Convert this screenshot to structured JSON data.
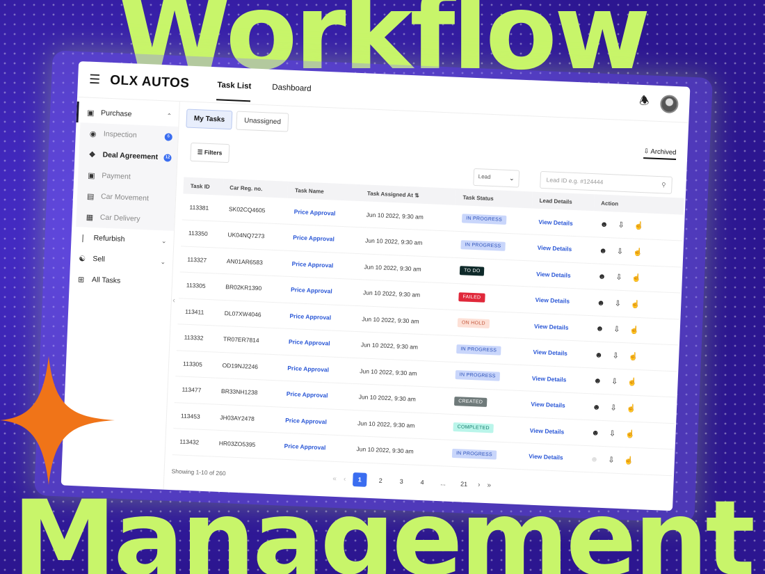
{
  "headline": {
    "top": "Workflow",
    "bottom": "Management"
  },
  "app": {
    "logo": "OLX AUTOS",
    "nav": [
      {
        "label": "Task List",
        "active": true
      },
      {
        "label": "Dashboard",
        "active": false
      }
    ]
  },
  "sidebar": {
    "purchase": "Purchase",
    "sub": [
      {
        "label": "Inspection",
        "badge": "6",
        "bold": false
      },
      {
        "label": "Deal Agreement",
        "badge": "12",
        "bold": true
      },
      {
        "label": "Payment",
        "badge": "",
        "bold": false
      },
      {
        "label": "Car Movement",
        "badge": "",
        "bold": false
      },
      {
        "label": "Car Delivery",
        "badge": "",
        "bold": false
      }
    ],
    "refurbish": "Refurbish",
    "sell": "Sell",
    "all_tasks": "All Tasks"
  },
  "main": {
    "tabs": [
      "My Tasks",
      "Unassigned"
    ],
    "archived": "Archived",
    "filters": "Filters",
    "lead_select": "Lead",
    "search_placeholder": "Lead ID e.g. #124444",
    "columns": [
      "Task ID",
      "Car Reg. no.",
      "Task Name",
      "Task Assigned At",
      "Task Status",
      "Lead Details",
      "Action"
    ],
    "rows": [
      {
        "id": "113381",
        "reg": "SK02CQ4605",
        "task": "Price Approval",
        "assigned": "Jun 10 2022, 9:30 am",
        "status": "IN PROGRESS",
        "lead": "View Details"
      },
      {
        "id": "113350",
        "reg": "UK04NQ7273",
        "task": "Price Approval",
        "assigned": "Jun 10 2022, 9:30 am",
        "status": "IN PROGRESS",
        "lead": "View Details"
      },
      {
        "id": "113327",
        "reg": "AN01AR6583",
        "task": "Price Approval",
        "assigned": "Jun 10 2022, 9:30 am",
        "status": "TO DO",
        "lead": "View Details"
      },
      {
        "id": "113305",
        "reg": "BR02KR1390",
        "task": "Price Approval",
        "assigned": "Jun 10 2022, 9:30 am",
        "status": "FAILED",
        "lead": "View Details"
      },
      {
        "id": "113411",
        "reg": "DL07XW4046",
        "task": "Price Approval",
        "assigned": "Jun 10 2022, 9:30 am",
        "status": "ON HOLD",
        "lead": "View Details"
      },
      {
        "id": "113332",
        "reg": "TR07ER7814",
        "task": "Price Approval",
        "assigned": "Jun 10 2022, 9:30 am",
        "status": "IN PROGRESS",
        "lead": "View Details"
      },
      {
        "id": "113305",
        "reg": "OD19NJ2246",
        "task": "Price Approval",
        "assigned": "Jun 10 2022, 9:30 am",
        "status": "IN PROGRESS",
        "lead": "View Details"
      },
      {
        "id": "113477",
        "reg": "BR33NH1238",
        "task": "Price Approval",
        "assigned": "Jun 10 2022, 9:30 am",
        "status": "CREATED",
        "lead": "View Details"
      },
      {
        "id": "113453",
        "reg": "JH03AY2478",
        "task": "Price Approval",
        "assigned": "Jun 10 2022, 9:30 am",
        "status": "COMPLETED",
        "lead": "View Details"
      },
      {
        "id": "113432",
        "reg": "HR03ZO5395",
        "task": "Price Approval",
        "assigned": "Jun 10 2022, 9:30 am",
        "status": "IN PROGRESS",
        "lead": "View Details"
      }
    ],
    "showing": "Showing 1-10 of 260",
    "pages": [
      "1",
      "2",
      "3",
      "4",
      "...",
      "21"
    ]
  },
  "status_colors": {
    "IN PROGRESS": {
      "bg": "#c9d6fb",
      "fg": "#2a4fb8"
    },
    "TO DO": {
      "bg": "#0f2a2a",
      "fg": "#ffffff"
    },
    "FAILED": {
      "bg": "#e0283a",
      "fg": "#ffffff"
    },
    "ON HOLD": {
      "bg": "#fde0d6",
      "fg": "#c2553a"
    },
    "CREATED": {
      "bg": "#6f7a7a",
      "fg": "#ffffff"
    },
    "COMPLETED": {
      "bg": "#baf5ea",
      "fg": "#127a6a"
    }
  }
}
